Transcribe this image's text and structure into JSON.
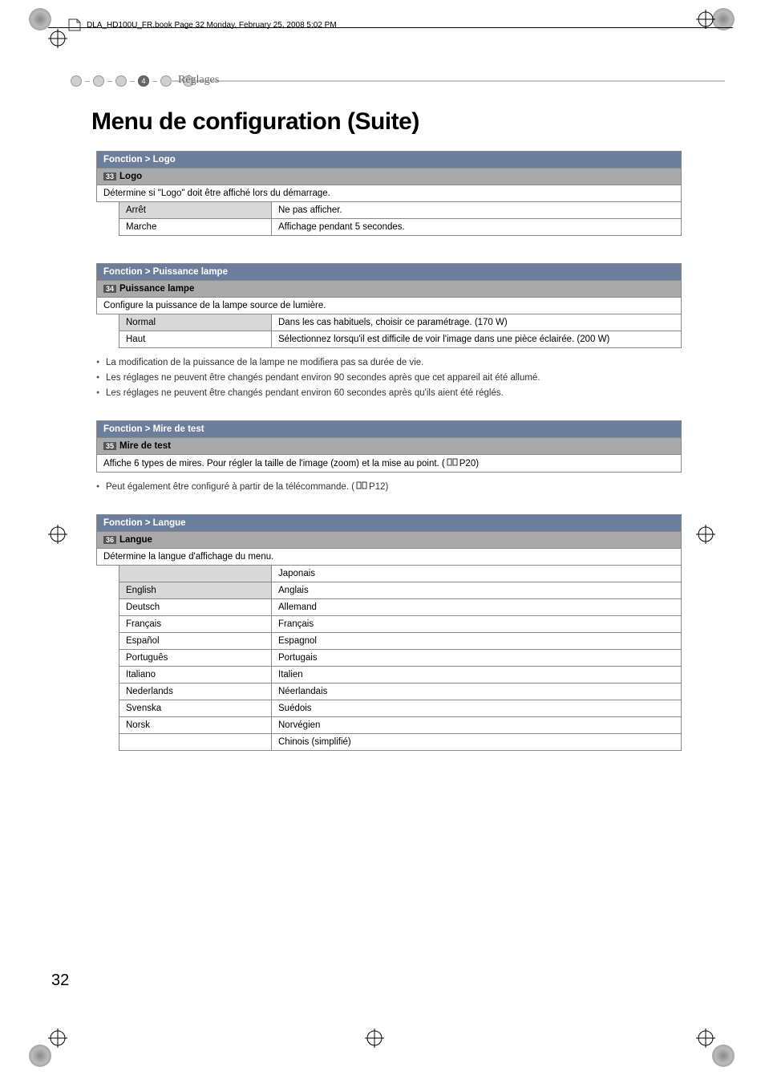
{
  "header_text": "DLA_HD100U_FR.book  Page 32  Monday, February 25, 2008  5:02 PM",
  "nav_badge": "4",
  "breadcrumb": "Réglages",
  "title": "Menu de configuration (Suite)",
  "page_number": "32",
  "logo": {
    "header": "Fonction > Logo",
    "badge": "33",
    "subheader": "Logo",
    "desc": "Détermine si \"Logo\" doit être affiché lors du démarrage.",
    "rows": [
      {
        "k": "Arrêt",
        "v": "Ne pas afficher."
      },
      {
        "k": "Marche",
        "v": "Affichage pendant 5 secondes."
      }
    ]
  },
  "lampe": {
    "header": "Fonction > Puissance lampe",
    "badge": "34",
    "subheader": "Puissance lampe",
    "desc": "Configure la puissance de la lampe source de lumière.",
    "rows": [
      {
        "k": "Normal",
        "v": "Dans les cas habituels, choisir ce paramétrage. (170 W)"
      },
      {
        "k": "Haut",
        "v": "Sélectionnez lorsqu'il est difficile de voir l'image dans une pièce éclairée. (200 W)"
      }
    ],
    "notes": [
      "La modification de la puissance de la lampe ne modifiera pas sa durée de vie.",
      "Les réglages ne peuvent être changés pendant environ 90 secondes après que cet appareil ait été allumé.",
      "Les réglages ne peuvent être changés pendant environ 60 secondes après qu'ils aient été réglés."
    ]
  },
  "mire": {
    "header": "Fonction > Mire de test",
    "badge": "35",
    "subheader": "Mire de test",
    "desc_pre": "Affiche 6 types de mires. Pour régler la taille de l'image (zoom) et la mise au point. (",
    "desc_ref": "P20",
    "desc_post": ")",
    "note_pre": "Peut également être configuré à partir de la télécommande. (",
    "note_ref": "P12",
    "note_post": ")"
  },
  "langue": {
    "header": "Fonction > Langue",
    "badge": "36",
    "subheader": "Langue",
    "desc": "Détermine la langue d'affichage du menu.",
    "rows": [
      {
        "k": "",
        "v": "Japonais"
      },
      {
        "k": "English",
        "v": "Anglais"
      },
      {
        "k": "Deutsch",
        "v": "Allemand"
      },
      {
        "k": "Français",
        "v": "Français"
      },
      {
        "k": "Español",
        "v": "Espagnol"
      },
      {
        "k": "Português",
        "v": "Portugais"
      },
      {
        "k": "Italiano",
        "v": "Italien"
      },
      {
        "k": "Nederlands",
        "v": "Néerlandais"
      },
      {
        "k": "Svenska",
        "v": "Suédois"
      },
      {
        "k": "Norsk",
        "v": "Norvégien"
      },
      {
        "k": "",
        "v": "Chinois (simplifié)"
      }
    ]
  }
}
